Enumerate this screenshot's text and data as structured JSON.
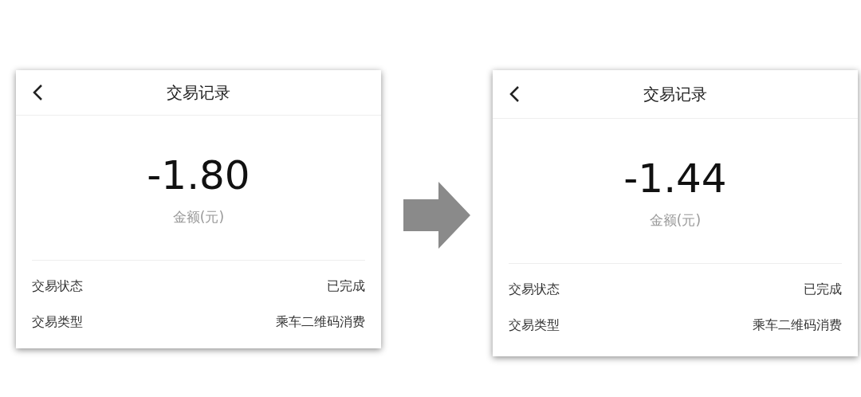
{
  "screens": [
    {
      "title": "交易记录",
      "amount": "-1.80",
      "amount_label": "金额(元)",
      "rows": [
        {
          "label": "交易状态",
          "value": "已完成"
        },
        {
          "label": "交易类型",
          "value": "乘车二维码消费"
        }
      ]
    },
    {
      "title": "交易记录",
      "amount": "-1.44",
      "amount_label": "金额(元)",
      "rows": [
        {
          "label": "交易状态",
          "value": "已完成"
        },
        {
          "label": "交易类型",
          "value": "乘车二维码消费"
        }
      ]
    }
  ]
}
